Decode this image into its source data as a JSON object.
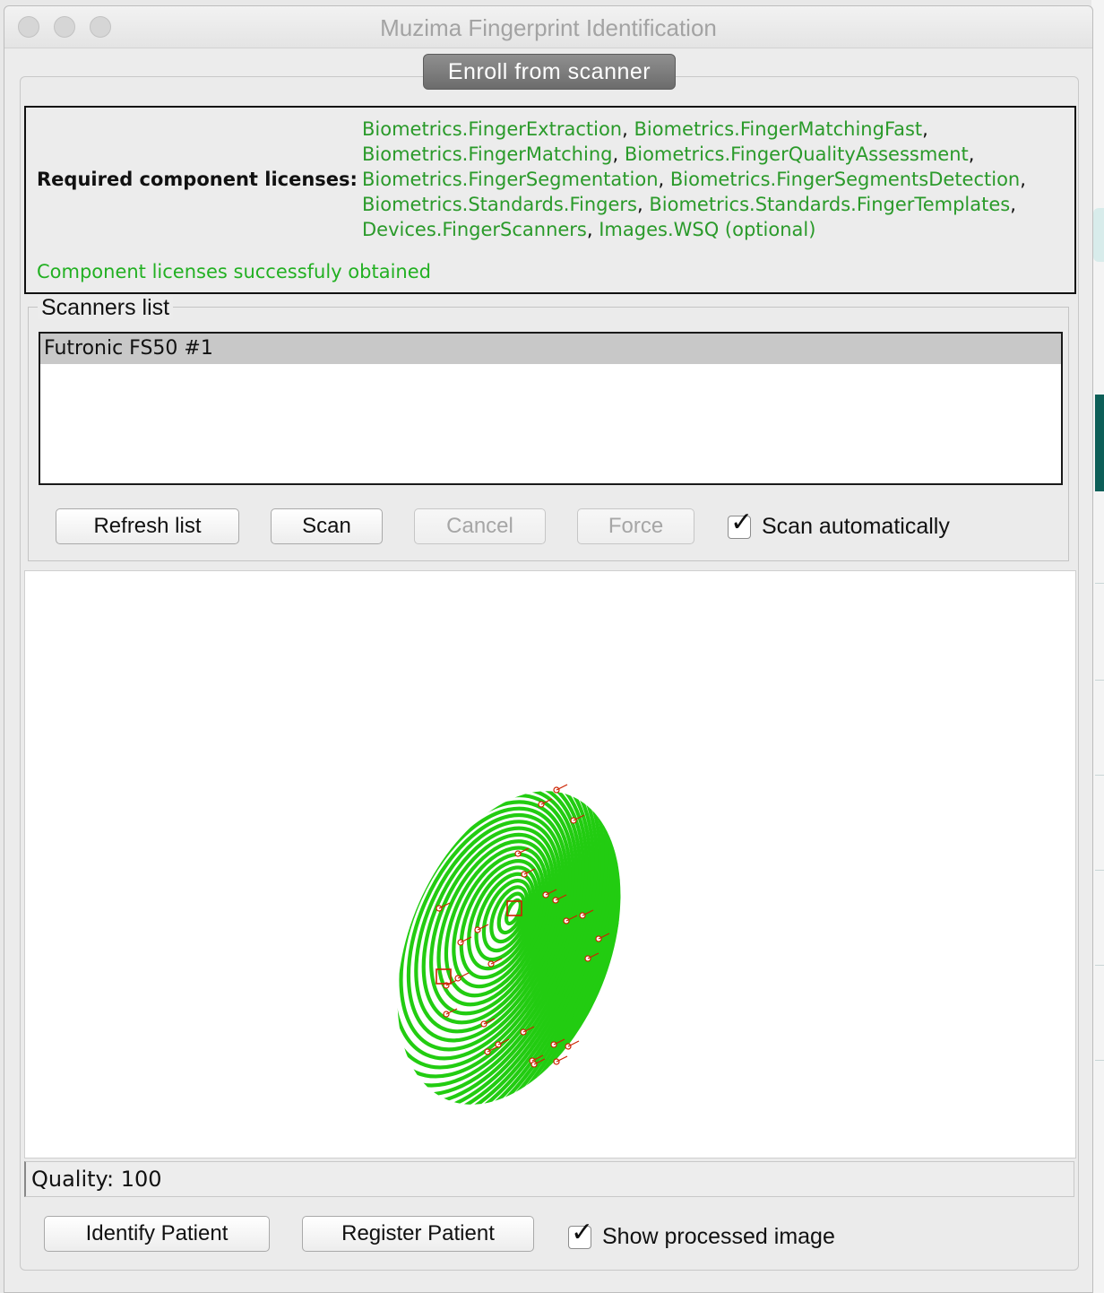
{
  "window": {
    "title": "Muzima Fingerprint Identification"
  },
  "tab": {
    "label": "Enroll from scanner"
  },
  "licenses": {
    "label": "Required component licenses:",
    "items": [
      "Biometrics.FingerExtraction",
      "Biometrics.FingerMatchingFast",
      "Biometrics.FingerMatching",
      "Biometrics.FingerQualityAssessment",
      "Biometrics.FingerSegmentation",
      "Biometrics.FingerSegmentsDetection",
      "Biometrics.Standards.Fingers",
      "Biometrics.Standards.FingerTemplates",
      "Devices.FingerScanners",
      "Images.WSQ (optional)"
    ],
    "status": "Component licenses successfuly obtained",
    "colors": {
      "item": "#2a9a2a",
      "status": "#22b022"
    }
  },
  "scanners": {
    "group_title": "Scanners list",
    "items": [
      "Futronic FS50 #1"
    ],
    "selected": "Futronic FS50 #1"
  },
  "toolbar": {
    "refresh_label": "Refresh list",
    "scan_label": "Scan",
    "cancel_label": "Cancel",
    "force_label": "Force",
    "scan_auto_label": "Scan automatically",
    "scan_auto_checked": true
  },
  "fingerprint": {
    "ridge_color": "#22cc11",
    "minutia_color": "#cc2200",
    "processed": true
  },
  "quality": {
    "text": "Quality: 100"
  },
  "bottom": {
    "identify_label": "Identify Patient",
    "register_label": "Register Patient",
    "show_processed_label": "Show processed image",
    "show_processed_checked": true
  }
}
